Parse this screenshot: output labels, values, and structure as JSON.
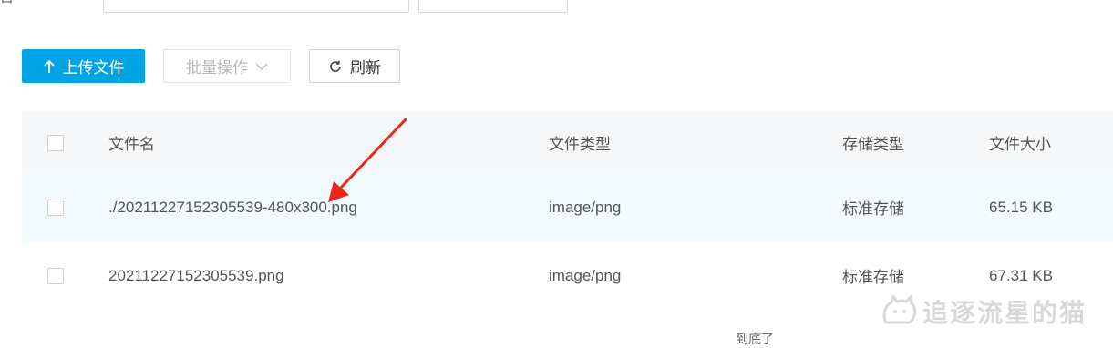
{
  "top": {
    "label": "目",
    "search_button_label": " "
  },
  "toolbar": {
    "upload_label": "上传文件",
    "batch_label": "批量操作",
    "refresh_label": "刷新"
  },
  "table": {
    "columns": [
      "文件名",
      "文件类型",
      "存储类型",
      "文件大小"
    ],
    "rows": [
      {
        "name": "./20211227152305539-480x300.png",
        "type": "image/png",
        "storage": "标准存储",
        "size": "65.15 KB"
      },
      {
        "name": "20211227152305539.png",
        "type": "image/png",
        "storage": "标准存储",
        "size": "67.31 KB"
      }
    ]
  },
  "footer": {
    "end_text": "到底了"
  },
  "watermark": {
    "text": "追逐流星的猫"
  },
  "colors": {
    "accent": "#00a4e4",
    "annotation_arrow": "#e8271b"
  },
  "icons": {
    "upload": "arrow-up-icon",
    "batch_dropdown": "chevron-down-icon",
    "refresh": "refresh-icon",
    "watermark_logo": "cat-logo-icon"
  }
}
